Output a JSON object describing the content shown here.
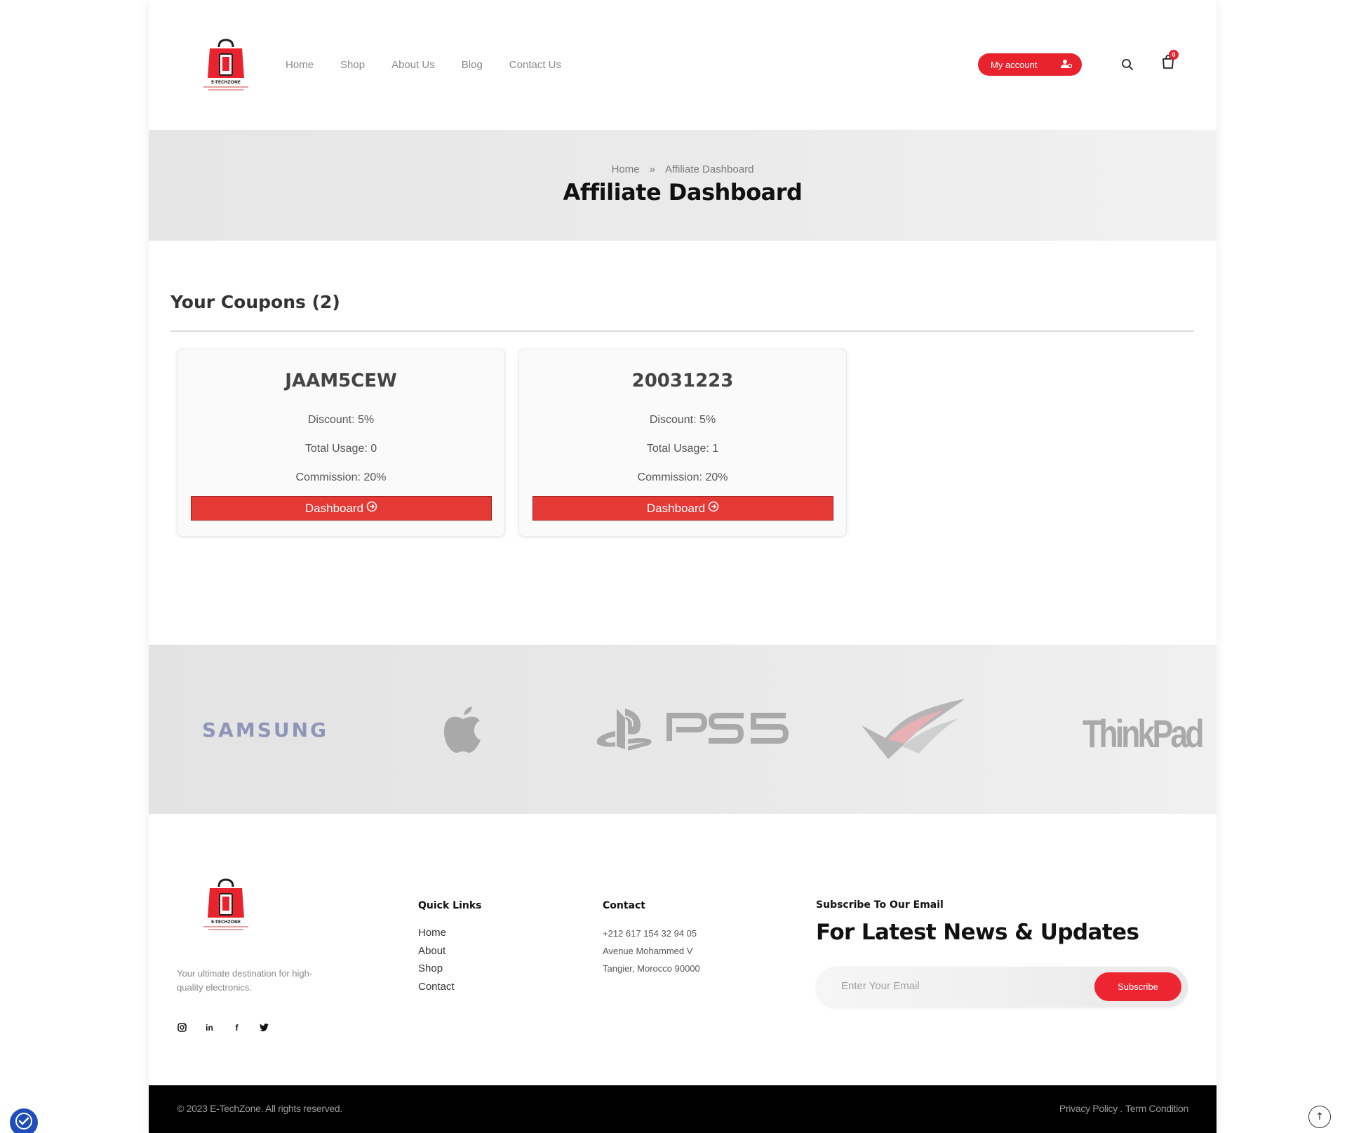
{
  "header": {
    "logo_text": "E-TECHZONE",
    "nav": [
      "Home",
      "Shop",
      "About Us",
      "Blog",
      "Contact Us"
    ],
    "account_label": "My account",
    "cart_count": "0"
  },
  "banner": {
    "breadcrumb_home": "Home",
    "breadcrumb_sep": "»",
    "breadcrumb_current": "Affiliate Dashboard",
    "title": "Affiliate Dashboard"
  },
  "coupons": {
    "heading": "Your Coupons (2)",
    "items": [
      {
        "code": "JAAM5CEW",
        "discount": "Discount: 5%",
        "usage": "Total Usage: 0",
        "commission": "Commission: 20%",
        "button": "Dashboard"
      },
      {
        "code": "20031223",
        "discount": "Discount: 5%",
        "usage": "Total Usage: 1",
        "commission": "Commission: 20%",
        "button": "Dashboard"
      }
    ]
  },
  "brands": {
    "samsung": "SAMSUNG",
    "ps5": "PS5",
    "thinkpad": "ThinkPad",
    "icons": [
      "apple-logo",
      "playstation-logo",
      "rog-logo"
    ]
  },
  "footer": {
    "logo_text": "E-TECHZONE",
    "tagline": "Your ultimate destination for high-quality electronics.",
    "socials": [
      "instagram-icon",
      "linkedin-icon",
      "facebook-icon",
      "twitter-icon"
    ],
    "quick_links_title": "Quick Links",
    "quick_links": [
      "Home",
      "About",
      "Shop",
      "Contact"
    ],
    "contact_title": "Contact",
    "contact": [
      "+212 617 154 32 94 05",
      "Avenue Mohammed V",
      "Tangier, Morocco 90000"
    ],
    "subscribe_title": "Subscribe To Our Email",
    "subscribe_heading": "For Latest News & Updates",
    "email_placeholder": "Enter Your Email",
    "subscribe_button": "Subscribe",
    "copyright": "© 2023 E-TechZone. All rights reserved.",
    "privacy": "Privacy Policy .",
    "terms": "Term Condition"
  },
  "colors": {
    "accent": "#e8232d",
    "button_red": "#e53935",
    "bottom_bar": "#000000",
    "a11y": "#1f4eb8"
  }
}
